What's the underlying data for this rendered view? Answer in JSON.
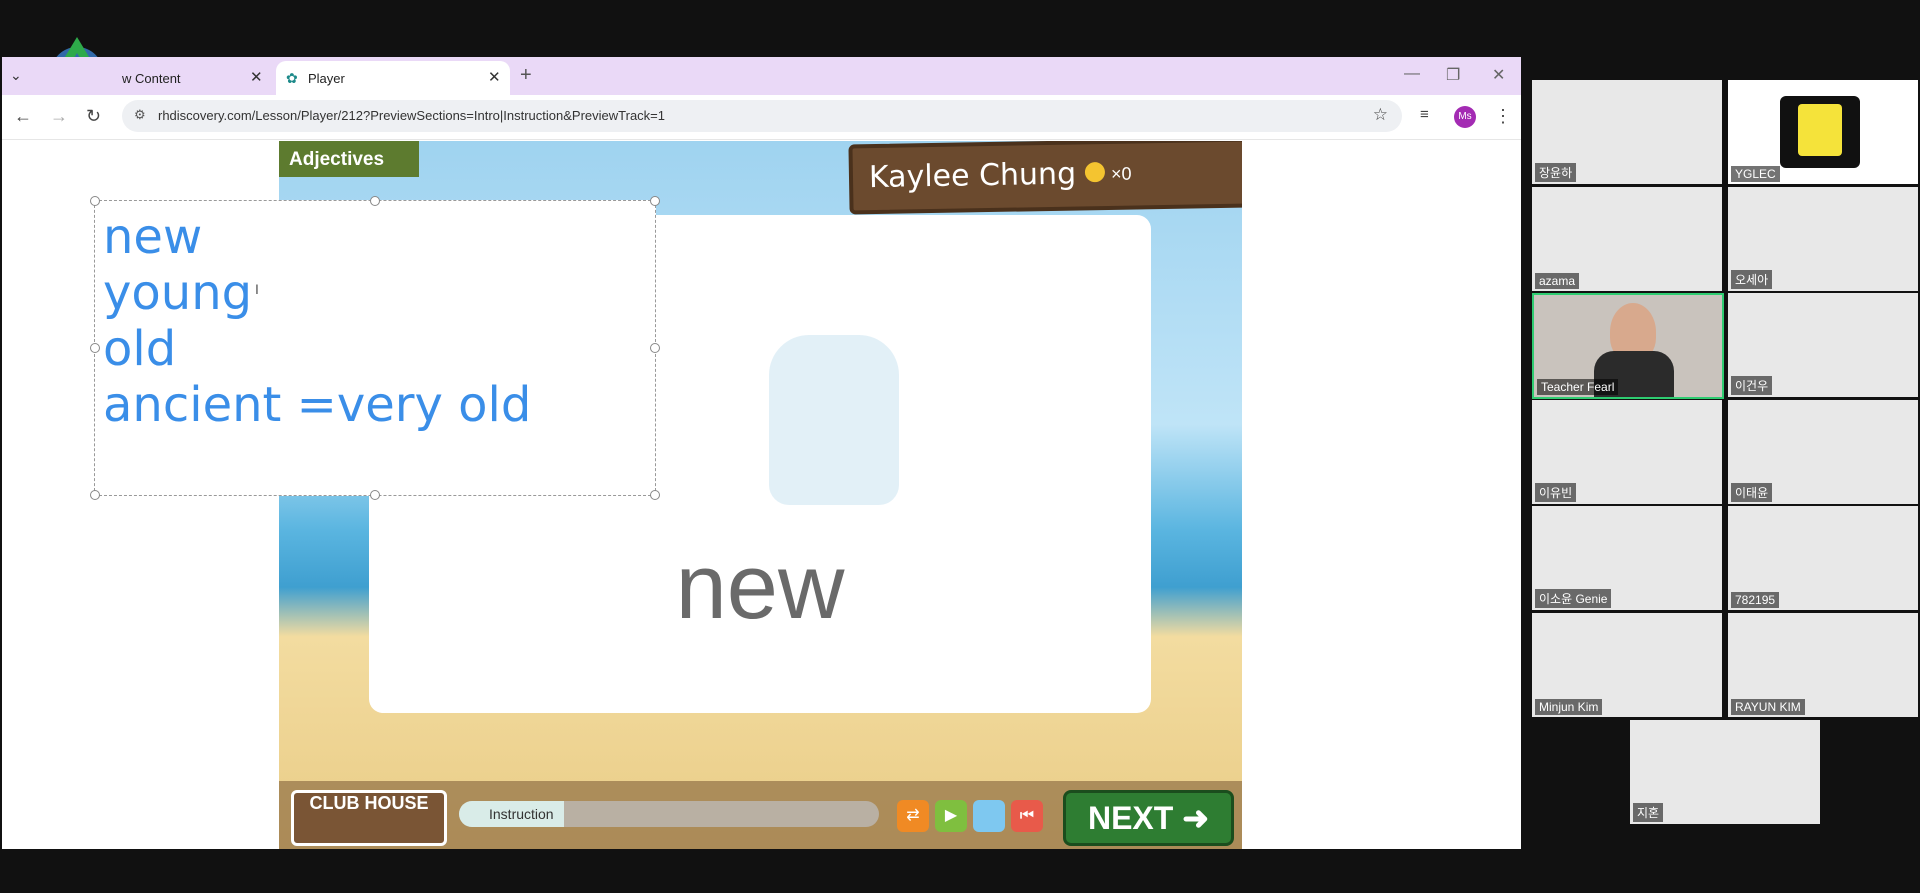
{
  "browser": {
    "tabs": [
      {
        "label": "w Content",
        "active": false
      },
      {
        "label": "Player",
        "active": true
      }
    ],
    "url": "rhdiscovery.com/Lesson/Player/212?PreviewSections=Intro|Instruction&PreviewTrack=1",
    "profile_initials": "Ms"
  },
  "lesson": {
    "topic": "Adjectives",
    "player_name": "Kaylee Chung",
    "coins": "×0",
    "big_word": "new",
    "club_house": "CLUB HOUSE",
    "progress_label": "Instruction",
    "progress_fraction": 0.25,
    "next_label": "NEXT"
  },
  "annotation": {
    "lines": [
      "new",
      "young",
      "old",
      "ancient =very old"
    ]
  },
  "participants": [
    {
      "name": "장윤하"
    },
    {
      "name": "YGLEC"
    },
    {
      "name": "azama"
    },
    {
      "name": "오세아"
    },
    {
      "name": "Teacher Fearl"
    },
    {
      "name": "이건우"
    },
    {
      "name": "이유빈"
    },
    {
      "name": "이태윤"
    },
    {
      "name": "이소윤 Genie"
    },
    {
      "name": "782195"
    },
    {
      "name": "Minjun Kim"
    },
    {
      "name": "RAYUN KIM"
    },
    {
      "name": "지혼"
    }
  ],
  "colors": {
    "accent": "#3a8ee8",
    "active_speaker": "#2ecc71"
  }
}
